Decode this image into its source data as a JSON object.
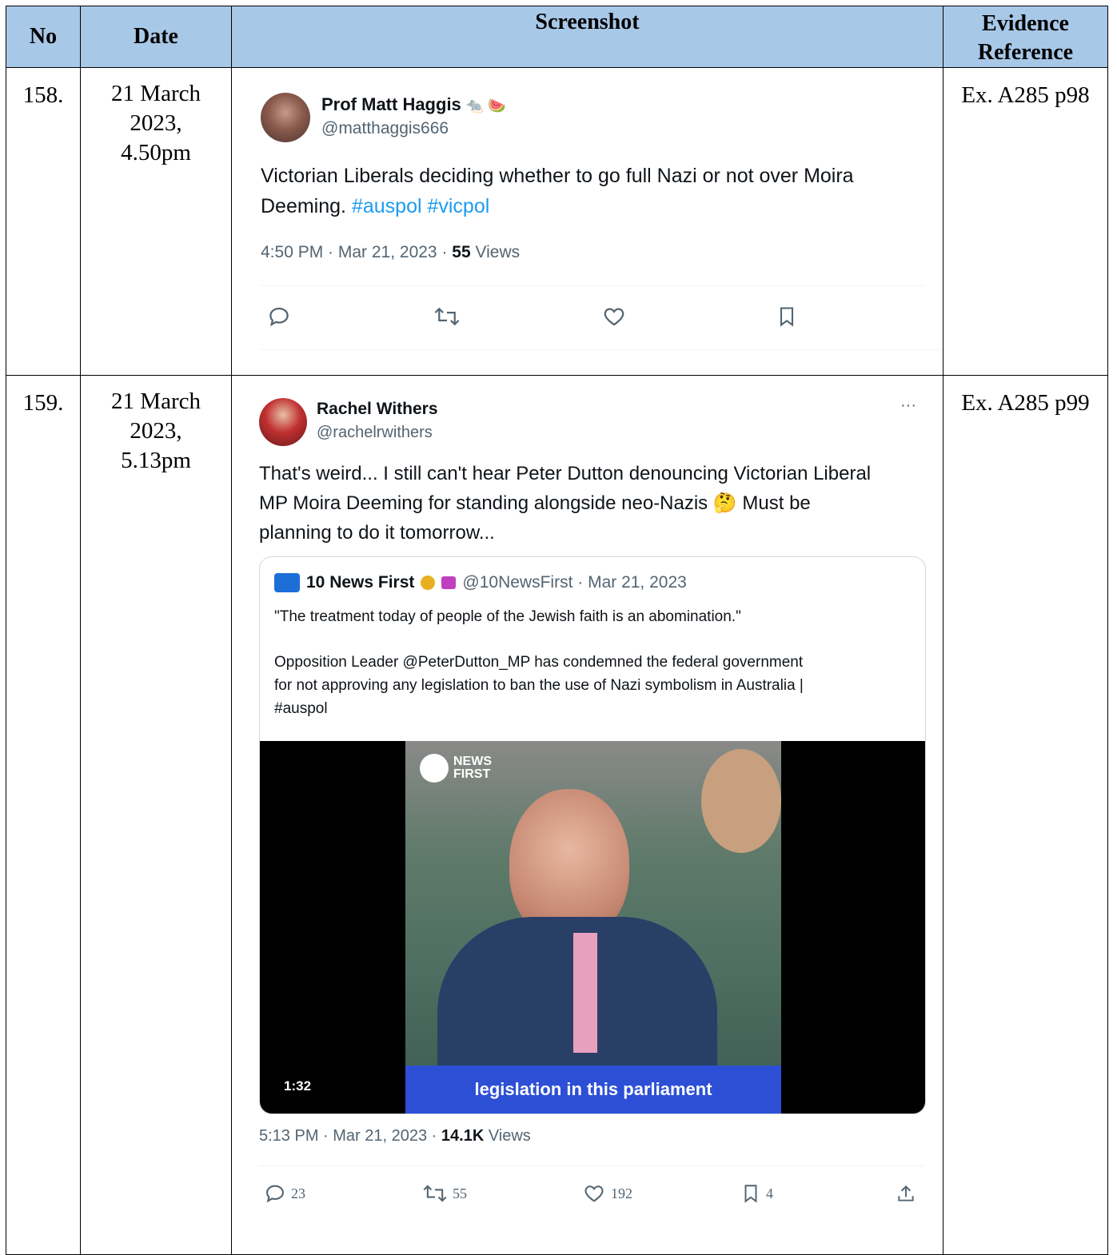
{
  "headers": {
    "no": "No",
    "date": "Date",
    "screenshot": "Screenshot",
    "evidence_line1": "Evidence",
    "evidence_line2": "Reference"
  },
  "rows": [
    {
      "no": "158.",
      "date_line1": "21 March",
      "date_line2": "2023,",
      "date_line3": "4.50pm",
      "reference": "Ex. A285 p98",
      "tweet": {
        "name": "Prof Matt Haggis",
        "name_emoji": "🐀 🍉",
        "handle": "@matthaggis666",
        "text": "Victorian Liberals deciding whether to go full Nazi or not over Moira Deeming. ",
        "hashtags": "#auspol #vicpol",
        "time": "4:50 PM · Mar 21, 2023 · ",
        "views_count": "55",
        "views_label": " Views"
      }
    },
    {
      "no": "159.",
      "date_line1": "21 March",
      "date_line2": "2023,",
      "date_line3": "5.13pm",
      "reference": "Ex. A285 p99",
      "tweet": {
        "name": "Rachel Withers",
        "handle": "@rachelrwithers",
        "more": "···",
        "text_line1": "That's weird... I still can't hear Peter Dutton denouncing Victorian Liberal",
        "text_line2": "MP Moira Deeming for standing alongside neo-Nazis 🤔 Must be",
        "text_line3": "planning to do it tomorrow...",
        "quote": {
          "name": "10 News First",
          "handle_date": "@10NewsFirst · Mar 21, 2023",
          "line1": "\"The treatment today of people of the Jewish faith is an abomination.\"",
          "line2": "Opposition Leader @PeterDutton_MP has condemned the federal government",
          "line3": "for not approving any legislation to ban the use of Nazi symbolism in Australia |",
          "line4": "#auspol",
          "video_logo_line1": "NEWS",
          "video_logo_line2": "FIRST",
          "video_caption": "legislation in this parliament",
          "video_duration": "1:32"
        },
        "time": "5:13 PM · Mar 21, 2023 · ",
        "views_count": "14.1K",
        "views_label": " Views",
        "replies": "23",
        "retweets": "55",
        "likes": "192",
        "bookmarks": "4"
      }
    }
  ],
  "colors": {
    "header_bg": "#a8c8e8",
    "link": "#1d9bf0",
    "muted": "#536471",
    "caption_bar": "#2d4fd6"
  }
}
